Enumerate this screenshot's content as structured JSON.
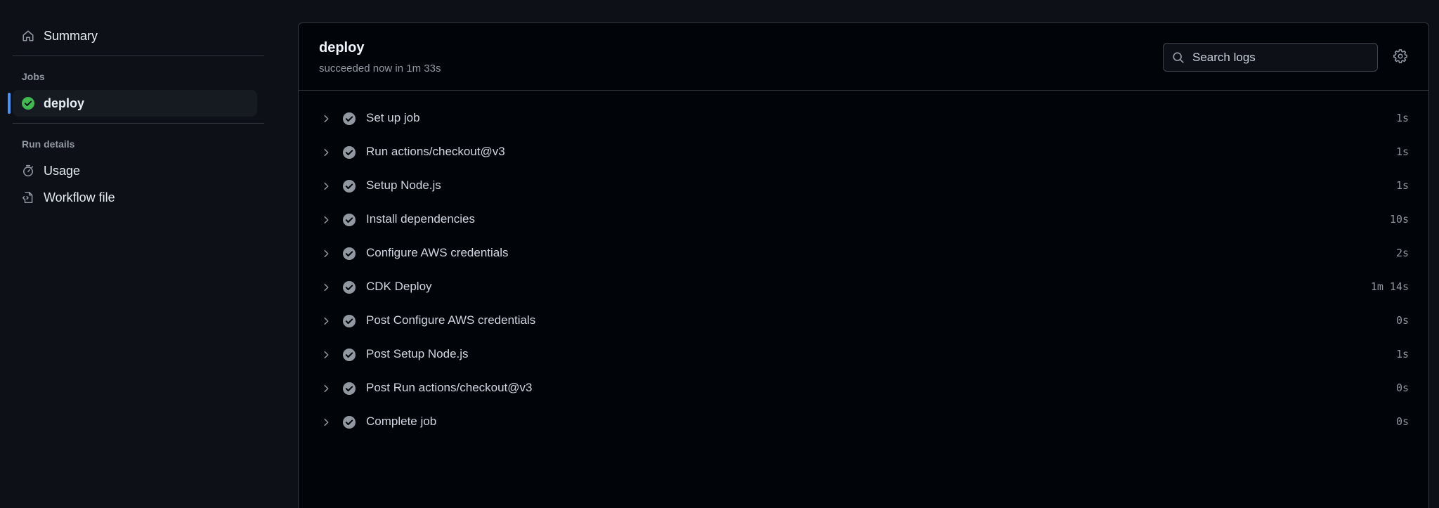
{
  "sidebar": {
    "summary_label": "Summary",
    "jobs_title": "Jobs",
    "job_label": "deploy",
    "run_details_title": "Run details",
    "usage_label": "Usage",
    "workflow_file_label": "Workflow file"
  },
  "header": {
    "job_title": "deploy",
    "subtitle": "succeeded now in 1m 33s",
    "search_placeholder": "Search logs"
  },
  "colors": {
    "success": "#3fb950",
    "step_check": "#9198a1",
    "accent": "#4493f8"
  },
  "steps": [
    {
      "name": "Set up job",
      "duration": "1s"
    },
    {
      "name": "Run actions/checkout@v3",
      "duration": "1s"
    },
    {
      "name": "Setup Node.js",
      "duration": "1s"
    },
    {
      "name": "Install dependencies",
      "duration": "10s"
    },
    {
      "name": "Configure AWS credentials",
      "duration": "2s"
    },
    {
      "name": "CDK Deploy",
      "duration": "1m 14s"
    },
    {
      "name": "Post Configure AWS credentials",
      "duration": "0s"
    },
    {
      "name": "Post Setup Node.js",
      "duration": "1s"
    },
    {
      "name": "Post Run actions/checkout@v3",
      "duration": "0s"
    },
    {
      "name": "Complete job",
      "duration": "0s"
    }
  ]
}
